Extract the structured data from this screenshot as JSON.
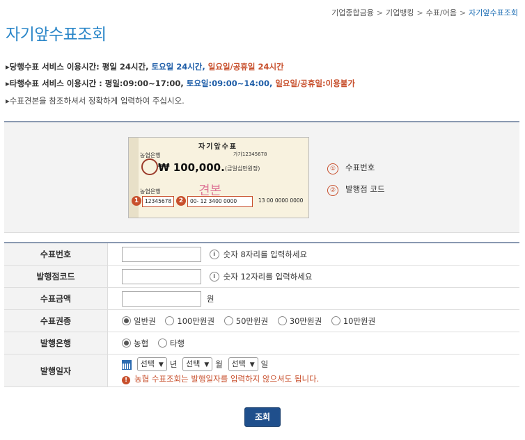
{
  "breadcrumb": {
    "items": [
      "기업종합금융",
      "기업뱅킹",
      "수표/어음"
    ],
    "current": "자기앞수표조회"
  },
  "page_title": "자기앞수표조회",
  "notices": {
    "own": {
      "prefix": "▸당행수표 서비스 이용시간: 평일 24시간,",
      "saturday": "토요일 24시간,",
      "holiday": "일요일/공휴일 24시간"
    },
    "other": {
      "prefix": "▸타행수표 서비스 이용시간 : 평일:09:00~17:00,",
      "saturday": "토요일:09:00~14:00,",
      "holiday": "일요일/공휴일:이용불가"
    },
    "guide": "▸수표견본을 참조하셔서 정확하게 입력하여 주십시오."
  },
  "cheque_sample": {
    "title": "자기앞수표",
    "bank": "농협은행",
    "amount": "₩ 100,000.",
    "amount_words": "(금일십만원정)",
    "serial": "가가12345678",
    "stamp": "견본",
    "field1": "12345678",
    "field2": "00- 12 3400 0000",
    "field3": "13 00 0000 0000",
    "marker1": "1",
    "marker2": "2"
  },
  "legend": [
    {
      "num": "①",
      "label": "수표번호"
    },
    {
      "num": "②",
      "label": "발행점 코드"
    }
  ],
  "form": {
    "cheque_number": {
      "label": "수표번호",
      "value": "",
      "hint": "숫자 8자리를 입력하세요"
    },
    "branch_code": {
      "label": "발행점코드",
      "value": "",
      "hint": "숫자 12자리를 입력하세요"
    },
    "amount": {
      "label": "수표금액",
      "value": "",
      "unit": "원"
    },
    "denomination": {
      "label": "수표권종",
      "options": [
        "일반권",
        "100만원권",
        "50만원권",
        "30만원권",
        "10만원권"
      ],
      "selected": "일반권"
    },
    "issuing_bank": {
      "label": "발행은행",
      "options": [
        "농협",
        "타행"
      ],
      "selected": "농협"
    },
    "issue_date": {
      "label": "발행일자",
      "year": "선택",
      "year_unit": "년",
      "month": "선택",
      "month_unit": "월",
      "day": "선택",
      "day_unit": "일",
      "warning": "농협 수표조회는 발행일자를 입력하지 않으셔도 됩니다."
    }
  },
  "submit_label": "조회",
  "icons": {
    "info": "info-icon",
    "warning": "exclamation-icon",
    "calendar": "calendar-icon"
  },
  "colors": {
    "title": "#2a86c8",
    "accent_blue": "#1f5ea8",
    "accent_red": "#c8502d",
    "submit": "#1f4f8c"
  }
}
